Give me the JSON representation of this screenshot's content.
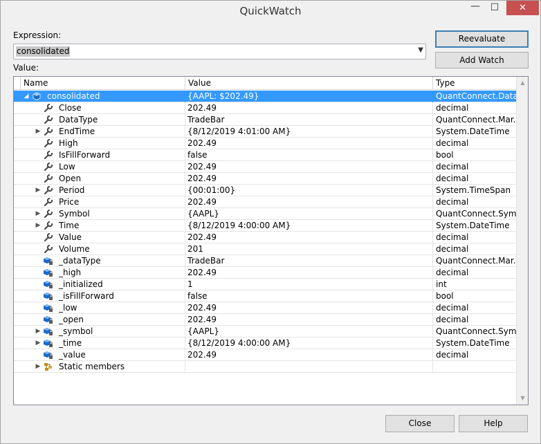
{
  "window": {
    "title": "QuickWatch",
    "min_glyph": "—",
    "max_glyph": "☐",
    "close_glyph": "✕"
  },
  "expression": {
    "label": "Expression:",
    "value": "consolidated",
    "dropdown_glyph": "▼"
  },
  "value_label": "Value:",
  "buttons": {
    "reevaluate": "Reevaluate",
    "add_watch": "Add Watch",
    "close": "Close",
    "help": "Help"
  },
  "grid": {
    "columns": {
      "name": "Name",
      "value": "Value",
      "type": "Type"
    },
    "rows": [
      {
        "name": "consolidated",
        "value": "{AAPL: $202.49}",
        "type": "QuantConnect.Data...",
        "level": 0,
        "expander": "◢",
        "icon": "object-icon",
        "selected": true
      },
      {
        "name": "Close",
        "value": "202.49",
        "type": "decimal",
        "level": 1,
        "expander": "",
        "icon": "property-icon"
      },
      {
        "name": "DataType",
        "value": "TradeBar",
        "type": "QuantConnect.Mar...",
        "level": 1,
        "expander": "",
        "icon": "property-icon"
      },
      {
        "name": "EndTime",
        "value": "{8/12/2019 4:01:00 AM}",
        "type": "System.DateTime",
        "level": 1,
        "expander": "▶",
        "icon": "property-icon"
      },
      {
        "name": "High",
        "value": "202.49",
        "type": "decimal",
        "level": 1,
        "expander": "",
        "icon": "property-icon"
      },
      {
        "name": "IsFillForward",
        "value": "false",
        "type": "bool",
        "level": 1,
        "expander": "",
        "icon": "property-icon"
      },
      {
        "name": "Low",
        "value": "202.49",
        "type": "decimal",
        "level": 1,
        "expander": "",
        "icon": "property-icon"
      },
      {
        "name": "Open",
        "value": "202.49",
        "type": "decimal",
        "level": 1,
        "expander": "",
        "icon": "property-icon"
      },
      {
        "name": "Period",
        "value": "{00:01:00}",
        "type": "System.TimeSpan",
        "level": 1,
        "expander": "▶",
        "icon": "property-icon"
      },
      {
        "name": "Price",
        "value": "202.49",
        "type": "decimal",
        "level": 1,
        "expander": "",
        "icon": "property-icon"
      },
      {
        "name": "Symbol",
        "value": "{AAPL}",
        "type": "QuantConnect.Sym...",
        "level": 1,
        "expander": "▶",
        "icon": "property-icon"
      },
      {
        "name": "Time",
        "value": "{8/12/2019 4:00:00 AM}",
        "type": "System.DateTime",
        "level": 1,
        "expander": "▶",
        "icon": "property-icon"
      },
      {
        "name": "Value",
        "value": "202.49",
        "type": "decimal",
        "level": 1,
        "expander": "",
        "icon": "property-icon"
      },
      {
        "name": "Volume",
        "value": "201",
        "type": "decimal",
        "level": 1,
        "expander": "",
        "icon": "property-icon"
      },
      {
        "name": "_dataType",
        "value": "TradeBar",
        "type": "QuantConnect.Mar...",
        "level": 1,
        "expander": "",
        "icon": "private-field-icon"
      },
      {
        "name": "_high",
        "value": "202.49",
        "type": "decimal",
        "level": 1,
        "expander": "",
        "icon": "private-field-icon"
      },
      {
        "name": "_initialized",
        "value": "1",
        "type": "int",
        "level": 1,
        "expander": "",
        "icon": "private-field-icon"
      },
      {
        "name": "_isFillForward",
        "value": "false",
        "type": "bool",
        "level": 1,
        "expander": "",
        "icon": "private-field-icon"
      },
      {
        "name": "_low",
        "value": "202.49",
        "type": "decimal",
        "level": 1,
        "expander": "",
        "icon": "private-field-icon"
      },
      {
        "name": "_open",
        "value": "202.49",
        "type": "decimal",
        "level": 1,
        "expander": "",
        "icon": "private-field-icon"
      },
      {
        "name": "_symbol",
        "value": "{AAPL}",
        "type": "QuantConnect.Sym...",
        "level": 1,
        "expander": "▶",
        "icon": "private-field-icon"
      },
      {
        "name": "_time",
        "value": "{8/12/2019 4:00:00 AM}",
        "type": "System.DateTime",
        "level": 1,
        "expander": "▶",
        "icon": "private-field-icon"
      },
      {
        "name": "_value",
        "value": "202.49",
        "type": "decimal",
        "level": 1,
        "expander": "",
        "icon": "private-field-icon"
      },
      {
        "name": "Static members",
        "value": "",
        "type": "",
        "level": 1,
        "expander": "▶",
        "icon": "static-members-icon"
      }
    ]
  },
  "scrollbar": {
    "up_glyph": "▲",
    "down_glyph": "▼"
  }
}
